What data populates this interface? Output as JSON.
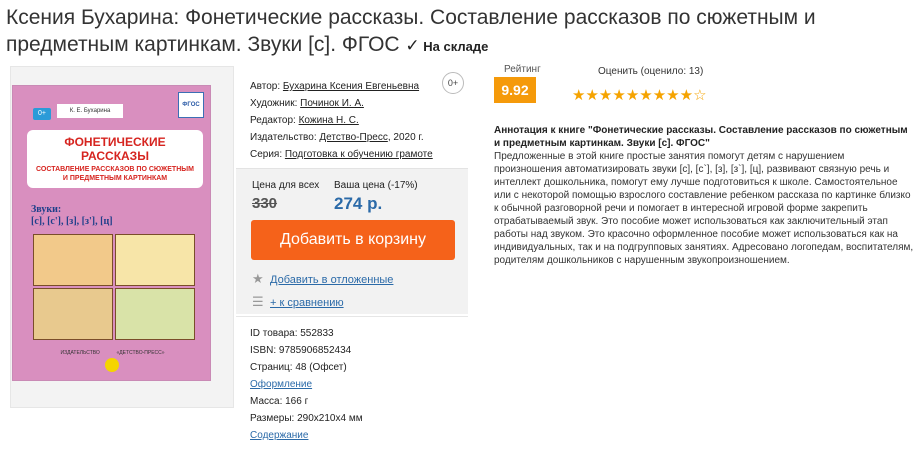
{
  "product": {
    "title": "Ксения Бухарина: Фонетические рассказы. Составление рассказов по сюжетным и предметным картинкам. Звуки [с]. ФГОС",
    "stock": "На складе"
  },
  "cover": {
    "author": "К. Е. Бухарина",
    "fgos": "ФГОС",
    "age": "0+",
    "title_main": "ФОНЕТИЧЕСКИЕ РАССКАЗЫ",
    "title_sub": "СОСТАВЛЕНИЕ РАССКАЗОВ ПО СЮЖЕТНЫМ И ПРЕДМЕТНЫМ КАРТИНКАМ",
    "sounds_label": "Звуки:",
    "sounds": "[с], [с'], [з], [з'], [ц]",
    "publisher_left": "ИЗДАТЕЛЬСТВО",
    "publisher_right": "«ДЕТСТВО-ПРЕСС»"
  },
  "info": {
    "author_label": "Автор:",
    "author": "Бухарина Ксения Евгеньевна",
    "illustrator_label": "Художник:",
    "illustrator": "Починок И. А.",
    "editor_label": "Редактор:",
    "editor": "Кожина Н. С.",
    "publisher_label": "Издательство:",
    "publisher": "Детство-Пресс",
    "year": ", 2020 г.",
    "series_label": "Серия:",
    "series": "Подготовка к обучению грамоте",
    "age_badge": "0+"
  },
  "buy": {
    "price_all_label": "Цена для всех",
    "your_price_label": "Ваша цена (-17%)",
    "old_price": "330",
    "new_price": "274 р.",
    "add_to_cart": "Добавить в корзину",
    "wishlist": "Добавить в отложенные",
    "compare": "+ к сравнению"
  },
  "details": {
    "id": "ID товара: 552833",
    "isbn": "ISBN: 9785906852434",
    "pages": "Страниц: 48 (Офсет)",
    "design": "Оформление",
    "weight": "Масса: 166 г",
    "size": "Размеры: 290x210x4 мм",
    "contents": "Содержание"
  },
  "rating": {
    "label": "Рейтинг",
    "score": "9.92",
    "rate_label": "Оценить (оценило: 13)",
    "stars_filled": 9.5,
    "stars_total": 10
  },
  "annotation": {
    "heading": "Аннотация к книге \"Фонетические рассказы. Составление рассказов по сюжетным и предметным картинкам. Звуки [с]. ФГОС\"",
    "text": "Предложенные в этой книге простые занятия помогут детям с нарушением произношения автоматизировать звуки [с], [с`], [з], [з`], [ц], развивают связную речь и интеллект дошкольника, помогут ему лучше подготовиться к школе. Самостоятельное или с некоторой помощью взрослого составление ребенком рассказа по картинке близко к обычной разговорной речи и помогает в интересной игровой форме закрепить отрабатываемый звук. Это пособие может использоваться как заключительный этап работы над звуком. Это красочно оформленное пособие может использоваться как на индивидуальных, так и на подгрупповых занятиях. Адресовано логопедам, воспитателям, родителям дошкольников с нарушенным звукопроизношением."
  }
}
